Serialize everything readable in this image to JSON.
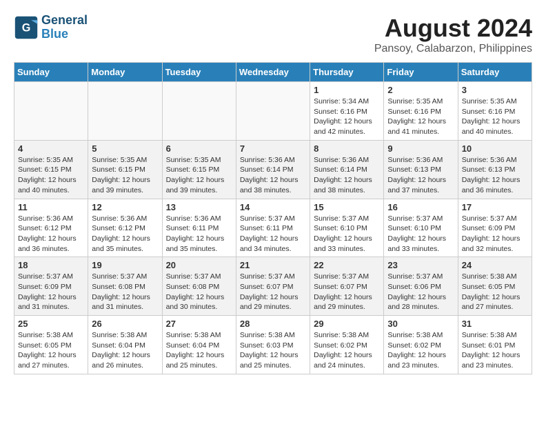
{
  "header": {
    "logo_line1": "General",
    "logo_line2": "Blue",
    "title": "August 2024",
    "subtitle": "Pansoy, Calabarzon, Philippines"
  },
  "weekdays": [
    "Sunday",
    "Monday",
    "Tuesday",
    "Wednesday",
    "Thursday",
    "Friday",
    "Saturday"
  ],
  "weeks": [
    [
      {
        "day": "",
        "info": ""
      },
      {
        "day": "",
        "info": ""
      },
      {
        "day": "",
        "info": ""
      },
      {
        "day": "",
        "info": ""
      },
      {
        "day": "1",
        "info": "Sunrise: 5:34 AM\nSunset: 6:16 PM\nDaylight: 12 hours\nand 42 minutes."
      },
      {
        "day": "2",
        "info": "Sunrise: 5:35 AM\nSunset: 6:16 PM\nDaylight: 12 hours\nand 41 minutes."
      },
      {
        "day": "3",
        "info": "Sunrise: 5:35 AM\nSunset: 6:16 PM\nDaylight: 12 hours\nand 40 minutes."
      }
    ],
    [
      {
        "day": "4",
        "info": "Sunrise: 5:35 AM\nSunset: 6:15 PM\nDaylight: 12 hours\nand 40 minutes."
      },
      {
        "day": "5",
        "info": "Sunrise: 5:35 AM\nSunset: 6:15 PM\nDaylight: 12 hours\nand 39 minutes."
      },
      {
        "day": "6",
        "info": "Sunrise: 5:35 AM\nSunset: 6:15 PM\nDaylight: 12 hours\nand 39 minutes."
      },
      {
        "day": "7",
        "info": "Sunrise: 5:36 AM\nSunset: 6:14 PM\nDaylight: 12 hours\nand 38 minutes."
      },
      {
        "day": "8",
        "info": "Sunrise: 5:36 AM\nSunset: 6:14 PM\nDaylight: 12 hours\nand 38 minutes."
      },
      {
        "day": "9",
        "info": "Sunrise: 5:36 AM\nSunset: 6:13 PM\nDaylight: 12 hours\nand 37 minutes."
      },
      {
        "day": "10",
        "info": "Sunrise: 5:36 AM\nSunset: 6:13 PM\nDaylight: 12 hours\nand 36 minutes."
      }
    ],
    [
      {
        "day": "11",
        "info": "Sunrise: 5:36 AM\nSunset: 6:12 PM\nDaylight: 12 hours\nand 36 minutes."
      },
      {
        "day": "12",
        "info": "Sunrise: 5:36 AM\nSunset: 6:12 PM\nDaylight: 12 hours\nand 35 minutes."
      },
      {
        "day": "13",
        "info": "Sunrise: 5:36 AM\nSunset: 6:11 PM\nDaylight: 12 hours\nand 35 minutes."
      },
      {
        "day": "14",
        "info": "Sunrise: 5:37 AM\nSunset: 6:11 PM\nDaylight: 12 hours\nand 34 minutes."
      },
      {
        "day": "15",
        "info": "Sunrise: 5:37 AM\nSunset: 6:10 PM\nDaylight: 12 hours\nand 33 minutes."
      },
      {
        "day": "16",
        "info": "Sunrise: 5:37 AM\nSunset: 6:10 PM\nDaylight: 12 hours\nand 33 minutes."
      },
      {
        "day": "17",
        "info": "Sunrise: 5:37 AM\nSunset: 6:09 PM\nDaylight: 12 hours\nand 32 minutes."
      }
    ],
    [
      {
        "day": "18",
        "info": "Sunrise: 5:37 AM\nSunset: 6:09 PM\nDaylight: 12 hours\nand 31 minutes."
      },
      {
        "day": "19",
        "info": "Sunrise: 5:37 AM\nSunset: 6:08 PM\nDaylight: 12 hours\nand 31 minutes."
      },
      {
        "day": "20",
        "info": "Sunrise: 5:37 AM\nSunset: 6:08 PM\nDaylight: 12 hours\nand 30 minutes."
      },
      {
        "day": "21",
        "info": "Sunrise: 5:37 AM\nSunset: 6:07 PM\nDaylight: 12 hours\nand 29 minutes."
      },
      {
        "day": "22",
        "info": "Sunrise: 5:37 AM\nSunset: 6:07 PM\nDaylight: 12 hours\nand 29 minutes."
      },
      {
        "day": "23",
        "info": "Sunrise: 5:37 AM\nSunset: 6:06 PM\nDaylight: 12 hours\nand 28 minutes."
      },
      {
        "day": "24",
        "info": "Sunrise: 5:38 AM\nSunset: 6:05 PM\nDaylight: 12 hours\nand 27 minutes."
      }
    ],
    [
      {
        "day": "25",
        "info": "Sunrise: 5:38 AM\nSunset: 6:05 PM\nDaylight: 12 hours\nand 27 minutes."
      },
      {
        "day": "26",
        "info": "Sunrise: 5:38 AM\nSunset: 6:04 PM\nDaylight: 12 hours\nand 26 minutes."
      },
      {
        "day": "27",
        "info": "Sunrise: 5:38 AM\nSunset: 6:04 PM\nDaylight: 12 hours\nand 25 minutes."
      },
      {
        "day": "28",
        "info": "Sunrise: 5:38 AM\nSunset: 6:03 PM\nDaylight: 12 hours\nand 25 minutes."
      },
      {
        "day": "29",
        "info": "Sunrise: 5:38 AM\nSunset: 6:02 PM\nDaylight: 12 hours\nand 24 minutes."
      },
      {
        "day": "30",
        "info": "Sunrise: 5:38 AM\nSunset: 6:02 PM\nDaylight: 12 hours\nand 23 minutes."
      },
      {
        "day": "31",
        "info": "Sunrise: 5:38 AM\nSunset: 6:01 PM\nDaylight: 12 hours\nand 23 minutes."
      }
    ]
  ]
}
